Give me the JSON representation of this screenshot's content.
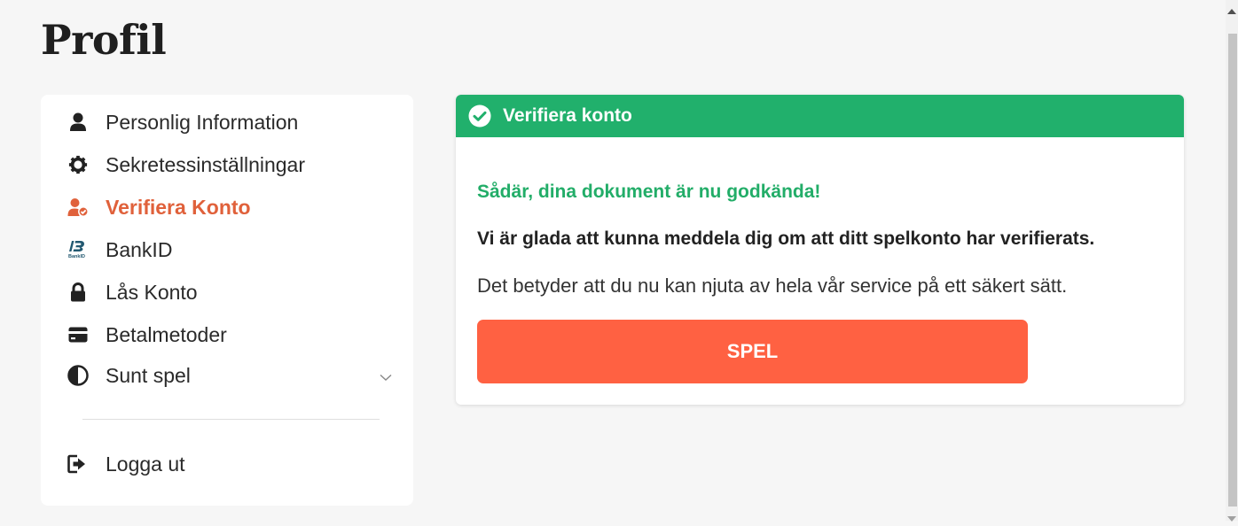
{
  "page": {
    "title": "Profil"
  },
  "sidebar": {
    "items": [
      {
        "label": "Personlig Information",
        "icon": "user-icon",
        "active": false
      },
      {
        "label": "Sekretessinställningar",
        "icon": "gear-icon",
        "active": false
      },
      {
        "label": "Verifiera Konto",
        "icon": "user-verified-icon",
        "active": true
      },
      {
        "label": "BankID",
        "icon": "bankid-icon",
        "active": false
      },
      {
        "label": "Lås Konto",
        "icon": "lock-icon",
        "active": false
      },
      {
        "label": "Betalmetoder",
        "icon": "credit-card-icon",
        "active": false
      },
      {
        "label": "Sunt spel",
        "icon": "half-circle-icon",
        "active": false,
        "expandable": true
      }
    ],
    "logout": {
      "label": "Logga ut",
      "icon": "sign-out-icon"
    },
    "bankid_logo_text": "BankID"
  },
  "card": {
    "header_title": "Verifiera konto",
    "success_message": "Sådär, dina dokument är nu godkända!",
    "headline": "Vi är glada att kunna meddela dig om att ditt spelkonto har verifierats.",
    "body": "Det betyder att du nu kan njuta av hela vår service på ett säkert sätt.",
    "button_label": "SPEL"
  },
  "colors": {
    "accent_orange": "#ff6142",
    "active_text": "#e0613b",
    "success_green": "#21b06c",
    "background": "#f6f6f6"
  }
}
